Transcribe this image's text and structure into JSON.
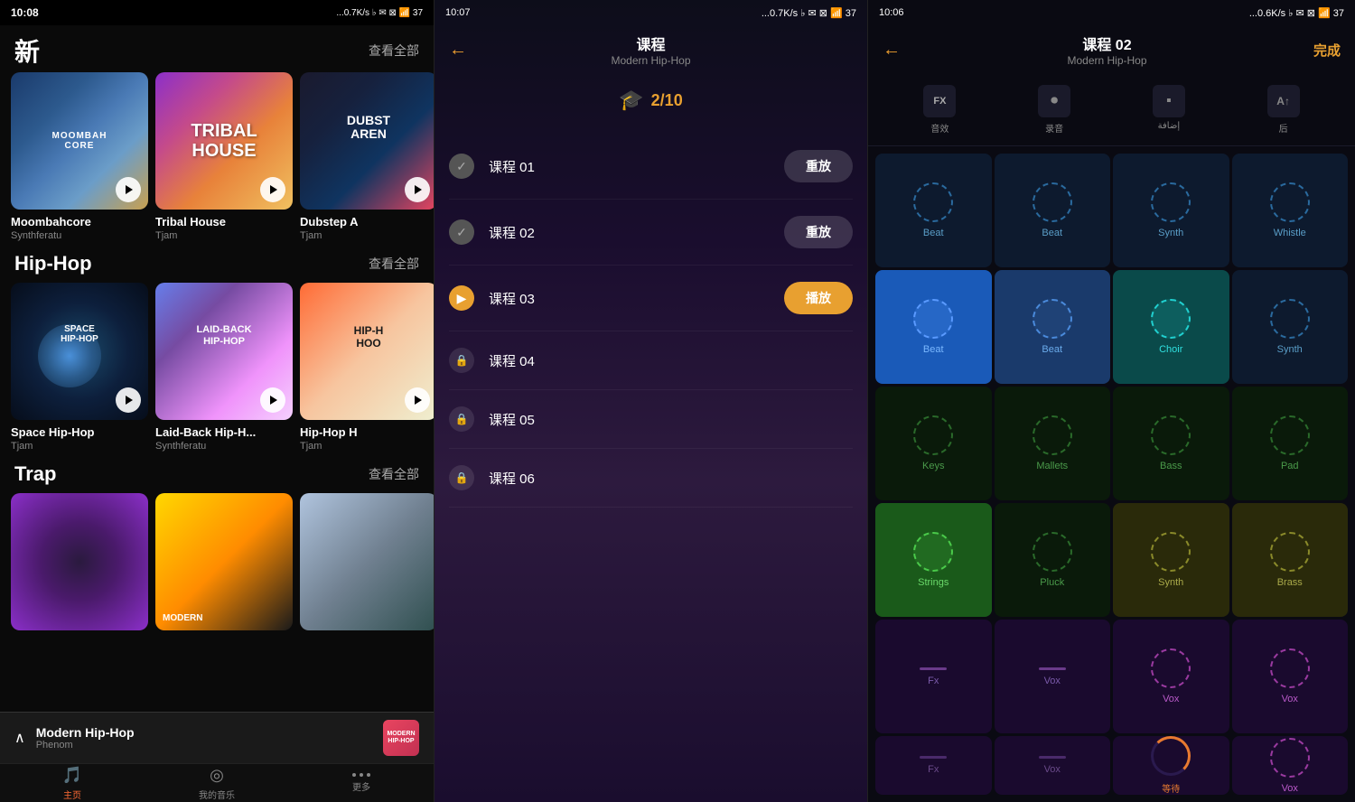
{
  "panel1": {
    "statusbar": {
      "time": "10:08",
      "signal": "...0.7K/s",
      "battery": "37"
    },
    "header": {
      "title": "新",
      "view_all": "查看全部"
    },
    "new_section": {
      "cards": [
        {
          "id": "moombahcore",
          "name": "Moombahcore",
          "author": "Synthferatu",
          "label": "MOOMBAHCORE"
        },
        {
          "id": "tribal",
          "name": "Tribal House",
          "author": "Tjam",
          "label": "TRIBAL HOUSE"
        },
        {
          "id": "dubstep",
          "name": "Dubstep A",
          "author": "Tjam",
          "label": "DUBST AREN"
        }
      ]
    },
    "hiphop_section": {
      "title": "Hip-Hop",
      "view_all": "查看全部",
      "cards": [
        {
          "id": "space",
          "name": "Space Hip-Hop",
          "author": "Tjam",
          "label": "SPACE HIP-HOP"
        },
        {
          "id": "laidback",
          "name": "Laid-Back Hip-H...",
          "author": "Synthferatu",
          "label": "LAID-BACK HIP-HOP"
        },
        {
          "id": "hiphoph",
          "name": "Hip-Hop H",
          "author": "Tjam",
          "label": "HIP-H HOO"
        }
      ]
    },
    "trap_section": {
      "title": "Trap",
      "view_all": "查看全部",
      "cards": [
        {
          "id": "trap1",
          "name": "",
          "author": "",
          "label": ""
        },
        {
          "id": "trap2",
          "name": "MODERN",
          "author": "",
          "label": "MODERN"
        },
        {
          "id": "trap3",
          "name": "",
          "author": "",
          "label": ""
        }
      ]
    },
    "player": {
      "song": "Modern Hip-Hop",
      "artist": "Phenom",
      "thumb_label": "MODERN HIP-HOP"
    },
    "nav": [
      {
        "id": "home",
        "icon": "♪",
        "label": "主页",
        "active": true
      },
      {
        "id": "music",
        "icon": "◎",
        "label": "我的音乐",
        "active": false
      },
      {
        "id": "more",
        "icon": "•••",
        "label": "更多",
        "active": false
      }
    ]
  },
  "panel2": {
    "statusbar": {
      "time": "10:07",
      "signal": "...0.7K/s",
      "battery": "37"
    },
    "header": {
      "back_icon": "←",
      "title": "课程",
      "subtitle": "Modern Hip-Hop"
    },
    "progress": {
      "icon": "🎓",
      "text": "2/10"
    },
    "courses": [
      {
        "id": "c1",
        "name": "课程 01",
        "status": "completed",
        "btn": "重放",
        "btn_type": "replay"
      },
      {
        "id": "c2",
        "name": "课程 02",
        "status": "completed",
        "btn": "重放",
        "btn_type": "replay"
      },
      {
        "id": "c3",
        "name": "课程 03",
        "status": "current",
        "btn": "播放",
        "btn_type": "play"
      },
      {
        "id": "c4",
        "name": "课程 04",
        "status": "locked",
        "btn": "",
        "btn_type": ""
      },
      {
        "id": "c5",
        "name": "课程 05",
        "status": "locked",
        "btn": "",
        "btn_type": ""
      },
      {
        "id": "c6",
        "name": "课程 06",
        "status": "locked",
        "btn": "",
        "btn_type": ""
      }
    ]
  },
  "panel3": {
    "statusbar": {
      "time": "10:06",
      "signal": "...0.6K/s",
      "battery": "37"
    },
    "header": {
      "back_icon": "←",
      "title": "课程 02",
      "subtitle": "Modern Hip-Hop",
      "done_btn": "完成"
    },
    "fx_toolbar": [
      {
        "id": "fx",
        "icon": "FX",
        "label": "音效"
      },
      {
        "id": "record",
        "icon": "⏺",
        "label": "录音"
      },
      {
        "id": "add",
        "icon": "▪",
        "label": "إضافة"
      },
      {
        "id": "text",
        "icon": "A↑",
        "label": "后"
      }
    ],
    "pads": [
      {
        "id": "p1",
        "label": "Beat",
        "type": "dark-blue"
      },
      {
        "id": "p2",
        "label": "Beat",
        "type": "dark-blue"
      },
      {
        "id": "p3",
        "label": "Synth",
        "type": "dark-blue"
      },
      {
        "id": "p4",
        "label": "Whistle",
        "type": "dark-blue"
      },
      {
        "id": "p5",
        "label": "Beat",
        "type": "active-blue"
      },
      {
        "id": "p6",
        "label": "Beat",
        "type": "dark-blue"
      },
      {
        "id": "p7",
        "label": "Choir",
        "type": "active-teal"
      },
      {
        "id": "p8",
        "label": "Synth",
        "type": "dark-blue"
      },
      {
        "id": "p9",
        "label": "Keys",
        "type": "dark-green"
      },
      {
        "id": "p10",
        "label": "Mallets",
        "type": "dark-green"
      },
      {
        "id": "p11",
        "label": "Bass",
        "type": "dark-green"
      },
      {
        "id": "p12",
        "label": "Pad",
        "type": "dark-green"
      },
      {
        "id": "p13",
        "label": "Strings",
        "type": "green-bright"
      },
      {
        "id": "p14",
        "label": "Pluck",
        "type": "dark-green"
      },
      {
        "id": "p15",
        "label": "Synth",
        "type": "olive"
      },
      {
        "id": "p16",
        "label": "Brass",
        "type": "olive"
      },
      {
        "id": "p17",
        "label": "Fx",
        "type": "fx-purple"
      },
      {
        "id": "p18",
        "label": "Vox",
        "type": "fx-purple"
      },
      {
        "id": "p19",
        "label": "Vox",
        "type": "vox-purple"
      },
      {
        "id": "p20",
        "label": "Vox",
        "type": "vox-purple"
      },
      {
        "id": "p21",
        "label": "Fx",
        "type": "fx-purple2"
      },
      {
        "id": "p22",
        "label": "Vox",
        "type": "fx-purple2"
      },
      {
        "id": "p23",
        "label": "等待",
        "type": "loading"
      },
      {
        "id": "p24",
        "label": "Vox",
        "type": "vox-purple2"
      }
    ]
  }
}
